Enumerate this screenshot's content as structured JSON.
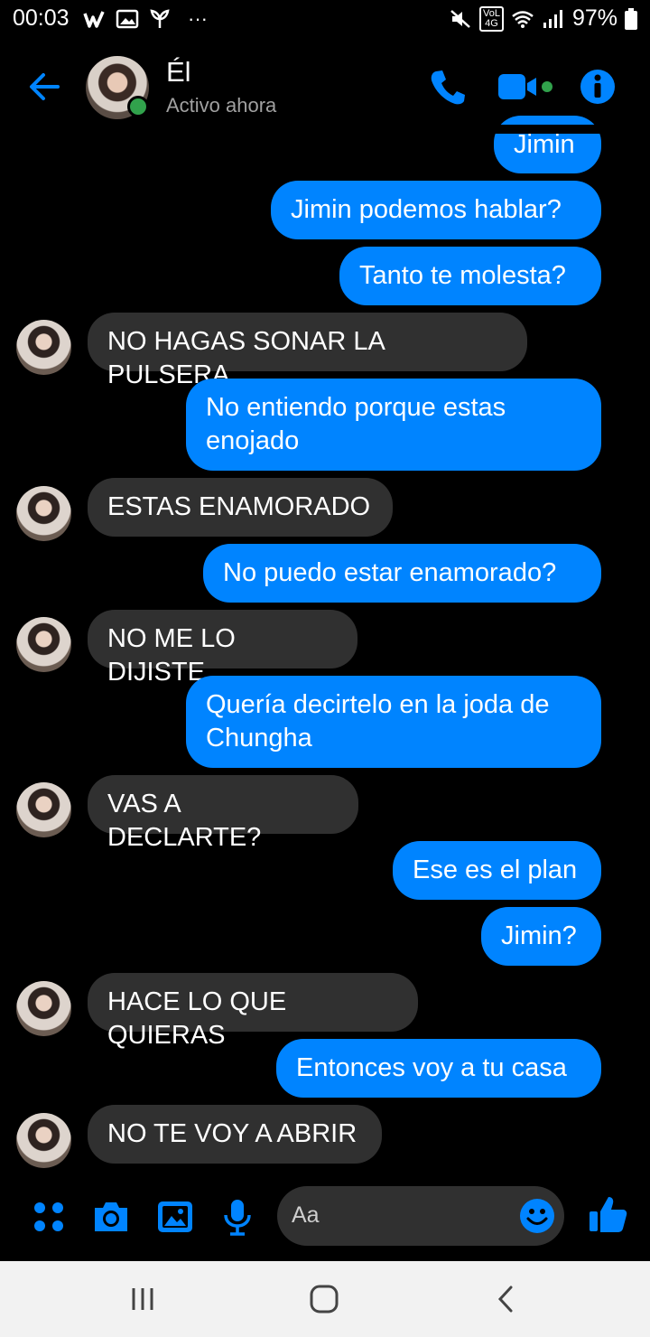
{
  "status_bar": {
    "time": "00:03",
    "more": "···",
    "battery": "97%",
    "network": "4G",
    "network_sub": "VoL"
  },
  "header": {
    "contact_name": "Él",
    "presence": "Activo ahora"
  },
  "messages": [
    {
      "from": "me",
      "text": "Jimin"
    },
    {
      "from": "me",
      "text": "Jimin podemos hablar?"
    },
    {
      "from": "me",
      "text": "Tanto te molesta?"
    },
    {
      "from": "them",
      "text": "NO HAGAS SONAR LA PULSERA"
    },
    {
      "from": "me",
      "text": "No entiendo porque estas enojado"
    },
    {
      "from": "them",
      "text": "ESTAS ENAMORADO"
    },
    {
      "from": "me",
      "text": "No puedo estar enamorado?"
    },
    {
      "from": "them",
      "text": "NO ME LO DIJISTE"
    },
    {
      "from": "me",
      "text": "Quería decirtelo en la joda de Chungha"
    },
    {
      "from": "them",
      "text": "VAS A DECLARTE?"
    },
    {
      "from": "me",
      "text": "Ese es el plan"
    },
    {
      "from": "me",
      "text": "Jimin?"
    },
    {
      "from": "them",
      "text": "HACE LO QUE QUIERAS"
    },
    {
      "from": "me",
      "text": "Entonces voy a tu casa"
    },
    {
      "from": "them",
      "text": "NO TE VOY A ABRIR"
    }
  ],
  "composer": {
    "placeholder": "Aa"
  },
  "icons": {
    "back": "back-arrow-icon",
    "call": "phone-icon",
    "video": "video-camera-icon",
    "info": "info-icon",
    "apps": "apps-icon",
    "camera": "camera-icon",
    "gallery": "image-icon",
    "mic": "microphone-icon",
    "emoji": "emoji-icon",
    "like": "thumbs-up-icon"
  },
  "colors": {
    "accent": "#0084ff",
    "incoming_bubble": "#303030",
    "online": "#31a24c",
    "background": "#000000"
  }
}
